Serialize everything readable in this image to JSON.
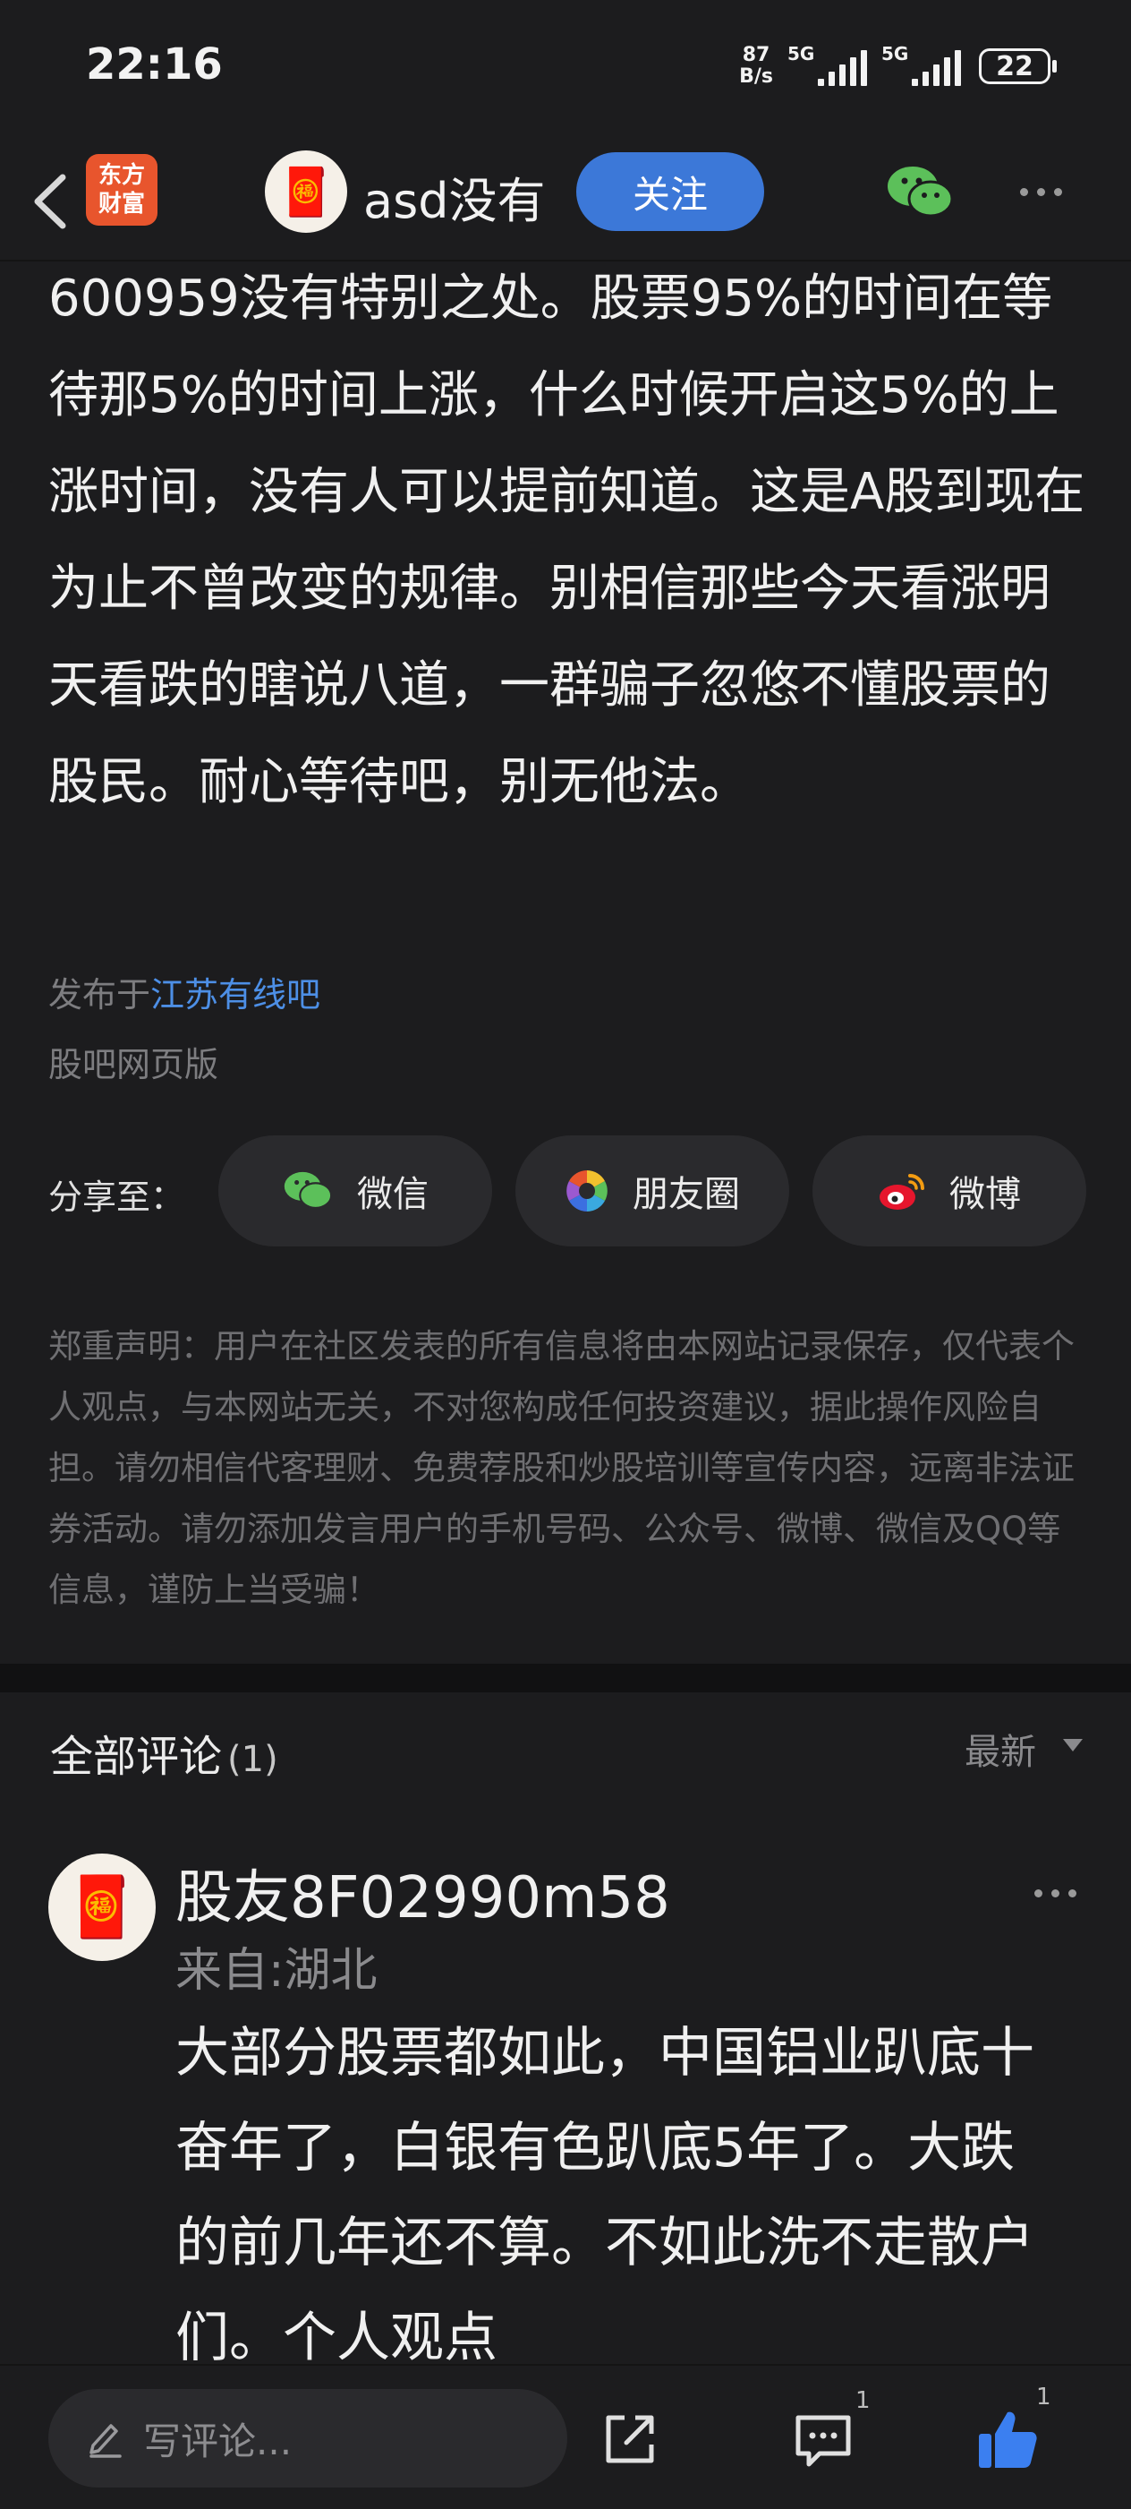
{
  "status": {
    "time": "22:16",
    "net_speed_value": "87",
    "net_speed_unit": "B/s",
    "signal1": "5G",
    "signal2": "5G",
    "battery": "22"
  },
  "nav": {
    "brand_line1": "东方",
    "brand_line2": "财富",
    "username": "asd没有",
    "follow_label": "关注"
  },
  "post": {
    "body": "600959没有特别之处。股票95%的时间在等待那5%的时间上涨，什么时候开启这5%的上涨时间，没有人可以提前知道。这是A股到现在为止不曾改变的规律。别相信那些今天看涨明天看跌的瞎说八道，一群骗子忽悠不懂股票的股民。耐心等待吧，别无他法。",
    "published_prefix": "发布于",
    "forum_link": "江苏有线吧",
    "source": "股吧网页版"
  },
  "share": {
    "label": "分享至：",
    "wechat": "微信",
    "moments": "朋友圈",
    "weibo": "微博"
  },
  "disclaimer": "郑重声明：用户在社区发表的所有信息将由本网站记录保存，仅代表个人观点，与本网站无关，不对您构成任何投资建议，据此操作风险自担。请勿相信代客理财、免费荐股和炒股培训等宣传内容，远离非法证券活动。请勿添加发言用户的手机号码、公众号、微博、微信及QQ等信息，谨防上当受骗！",
  "comments": {
    "title": "全部评论",
    "count": "(1)",
    "sort": "最新",
    "items": [
      {
        "user": "股友8F02990m58",
        "location": "来自:湖北",
        "text": "大部分股票都如此，中国铝业趴底十奋年了，白银有色趴底5年了。大跌的前几年还不算。不如此洗不走散户们。个人观点"
      }
    ]
  },
  "bottom": {
    "write_placeholder": "写评论...",
    "comment_badge": "1",
    "like_badge": "1"
  },
  "colors": {
    "accent": "#3c78d8",
    "link": "#4d8fe6",
    "brand": "#e8552d",
    "like": "#3b7ff0",
    "wechat": "#5cc05a"
  }
}
